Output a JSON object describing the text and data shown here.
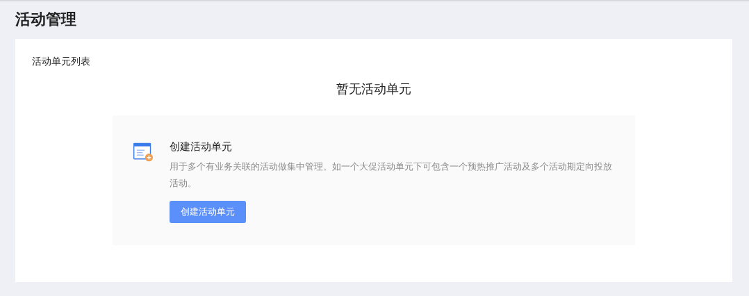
{
  "page_title": "活动管理",
  "card": {
    "title": "活动单元列表",
    "empty_title": "暂无活动单元",
    "guide": {
      "heading": "创建活动单元",
      "description": "用于多个有业务关联的活动做集中管理。如一个大促活动单元下可包含一个预热推广活动及多个活动期定向投放活动。",
      "button": "创建活动单元"
    }
  }
}
